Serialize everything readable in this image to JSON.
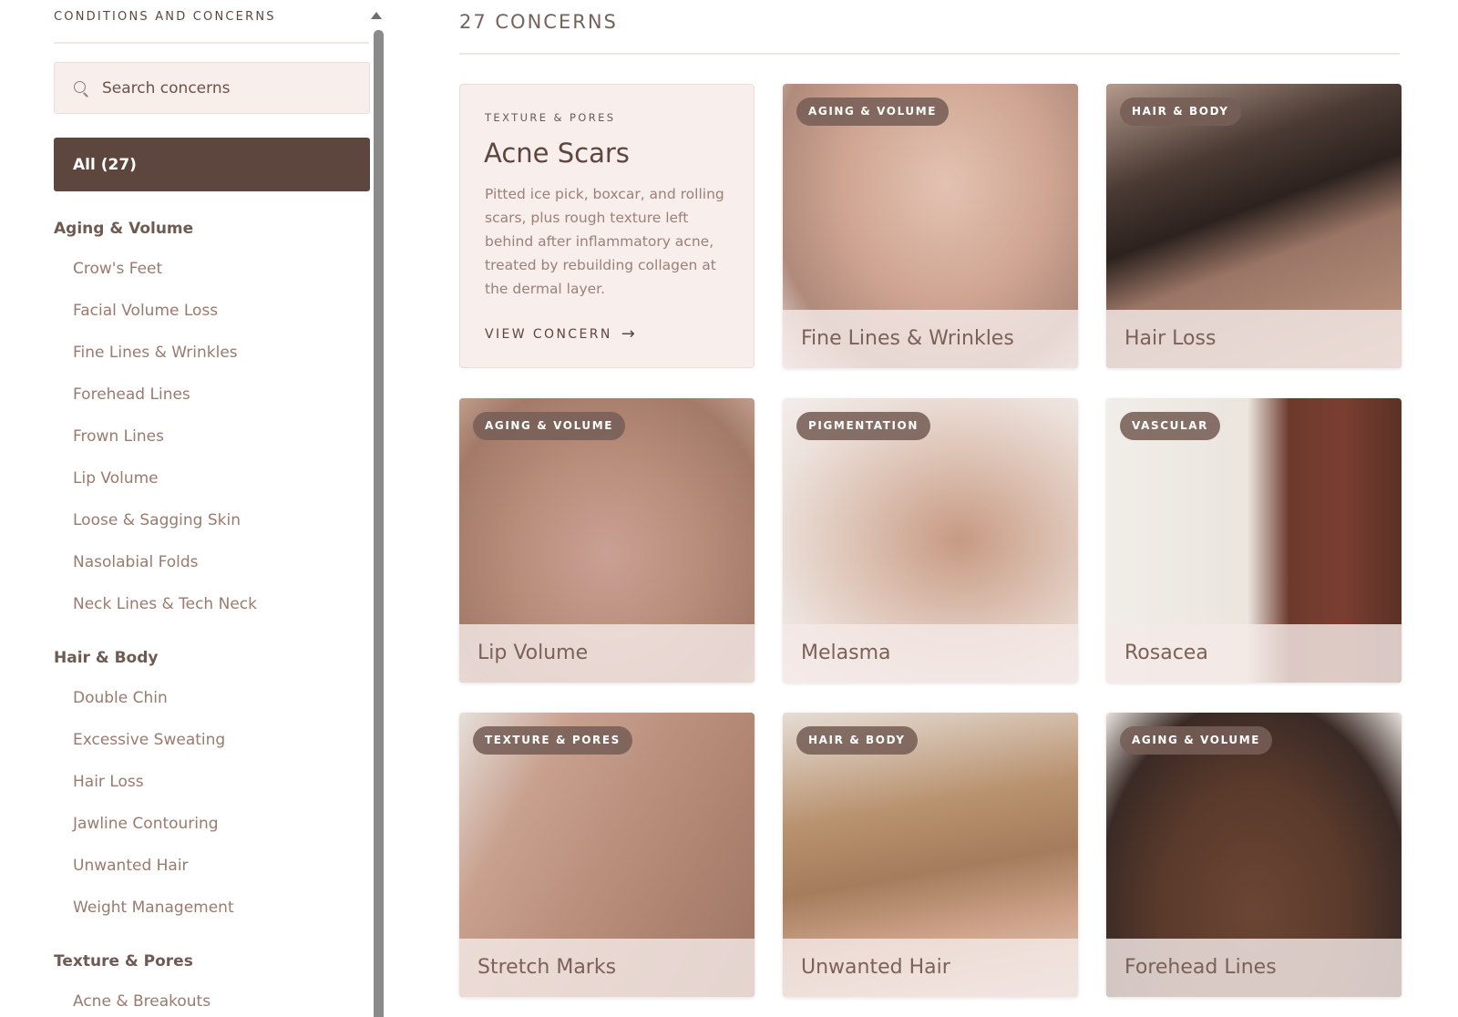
{
  "sidebar": {
    "header": "CONDITIONS AND CONCERNS",
    "search": {
      "placeholder": "Search concerns",
      "value": ""
    },
    "all_label": "All (27)",
    "groups": [
      {
        "title": "Aging & Volume",
        "items": [
          "Crow's Feet",
          "Facial Volume Loss",
          "Fine Lines & Wrinkles",
          "Forehead Lines",
          "Frown Lines",
          "Lip Volume",
          "Loose & Sagging Skin",
          "Nasolabial Folds",
          "Neck Lines & Tech Neck"
        ]
      },
      {
        "title": "Hair & Body",
        "items": [
          "Double Chin",
          "Excessive Sweating",
          "Hair Loss",
          "Jawline Contouring",
          "Unwanted Hair",
          "Weight Management"
        ]
      },
      {
        "title": "Texture & Pores",
        "items": [
          "Acne & Breakouts"
        ]
      }
    ]
  },
  "main": {
    "title": "27 CONCERNS",
    "featured": {
      "tag": "TEXTURE & PORES",
      "title": "Acne Scars",
      "description": "Pitted ice pick, boxcar, and rolling scars, plus rough texture left behind after inflammatory acne, treated by rebuilding collagen at the dermal layer.",
      "link": "VIEW CONCERN",
      "link_icon": "arrow-right-icon"
    },
    "cards": [
      {
        "badge": "AGING & VOLUME",
        "caption": "Fine Lines & Wrinkles"
      },
      {
        "badge": "HAIR & BODY",
        "caption": "Hair Loss"
      },
      {
        "badge": "AGING & VOLUME",
        "caption": "Lip Volume"
      },
      {
        "badge": "PIGMENTATION",
        "caption": "Melasma"
      },
      {
        "badge": "VASCULAR",
        "caption": "Rosacea"
      },
      {
        "badge": "TEXTURE & PORES",
        "caption": "Stretch Marks"
      },
      {
        "badge": "HAIR & BODY",
        "caption": "Unwanted Hair"
      },
      {
        "badge": "AGING & VOLUME",
        "caption": "Forehead Lines"
      }
    ]
  },
  "colors": {
    "accent_dark": "#5c463e",
    "card_bg": "#f8eeec",
    "text_muted": "#9b7a6e"
  }
}
